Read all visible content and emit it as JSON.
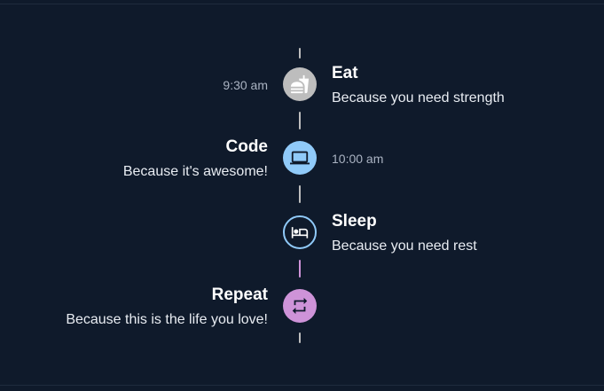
{
  "timeline": {
    "items": [
      {
        "title": "Eat",
        "description": "Because you need strength",
        "time": "9:30 am",
        "icon": "fastfood-icon",
        "dot_color": "#bdbdbd"
      },
      {
        "title": "Code",
        "description": "Because it's awesome!",
        "time": "10:00 am",
        "icon": "laptop-icon",
        "dot_color": "#90caf9"
      },
      {
        "title": "Sleep",
        "description": "Because you need rest",
        "time": "",
        "icon": "hotel-bed-icon",
        "dot_color": "#90caf9"
      },
      {
        "title": "Repeat",
        "description": "Because this is the life you love!",
        "time": "",
        "icon": "repeat-icon",
        "dot_color": "#ce93d8"
      }
    ]
  }
}
